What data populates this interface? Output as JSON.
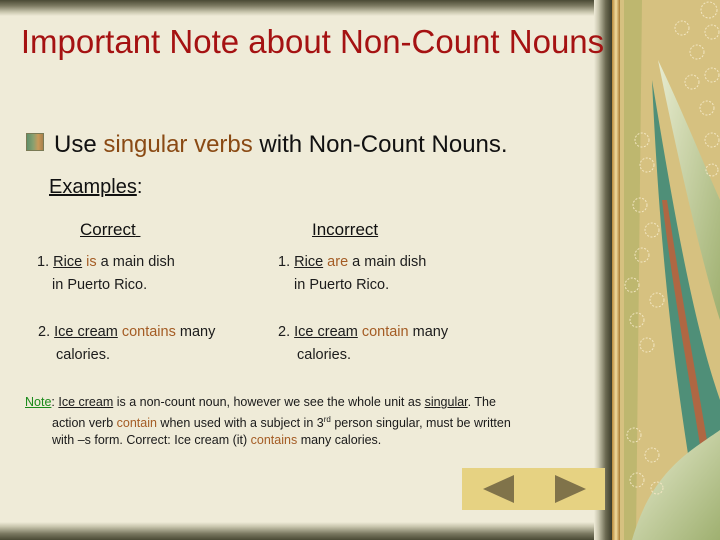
{
  "slide": {
    "title": "Important Note about Non-Count Nouns",
    "bullet": {
      "prefix": "Use ",
      "highlight": "singular verbs",
      "suffix": " with Non-Count Nouns."
    },
    "examples_label": "Examples",
    "examples_colon": ":",
    "columns": {
      "correct": "Correct",
      "incorrect": "Incorrect"
    },
    "correct_examples": [
      {
        "num": "1. ",
        "subject": "Rice",
        "verb": "is",
        "rest": " a main dish",
        "line2": "in Puerto Rico."
      },
      {
        "num": "2. ",
        "subject": "Ice cream",
        "verb": "contains",
        "rest": " many",
        "line2": "calories."
      }
    ],
    "incorrect_examples": [
      {
        "num": "1. ",
        "subject": "Rice",
        "verb": "are",
        "rest": " a main dish",
        "line2": "in Puerto Rico."
      },
      {
        "num": "2. ",
        "subject": "Ice cream",
        "verb": "contain",
        "rest": " many",
        "line2": "calories."
      }
    ],
    "note": {
      "label": "Note",
      "colon": ": ",
      "subject": "Ice cream",
      "text1": " is a non-count noun, however we see the whole unit as ",
      "singular": "singular",
      "text2": ".  The",
      "line2_a": "action verb ",
      "line2_verb": "contain",
      "line2_b": " when used with a subject in 3",
      "line2_sup": "rd",
      "line2_c": " person singular, must be written",
      "line3_a": "with –s form.   Correct: Ice cream (it) ",
      "line3_verb": "contains",
      "line3_b": " many calories."
    }
  },
  "navigation": {
    "prev_icon": "triangle-left",
    "next_icon": "triangle-right"
  },
  "colors": {
    "title": "#a51212",
    "highlight": "#8a4a14",
    "verb": "#a45c24",
    "note_label": "#1a8a1a",
    "background": "#efebd8",
    "nav_bar": "#e6d282",
    "nav_arrow": "#80734a"
  }
}
